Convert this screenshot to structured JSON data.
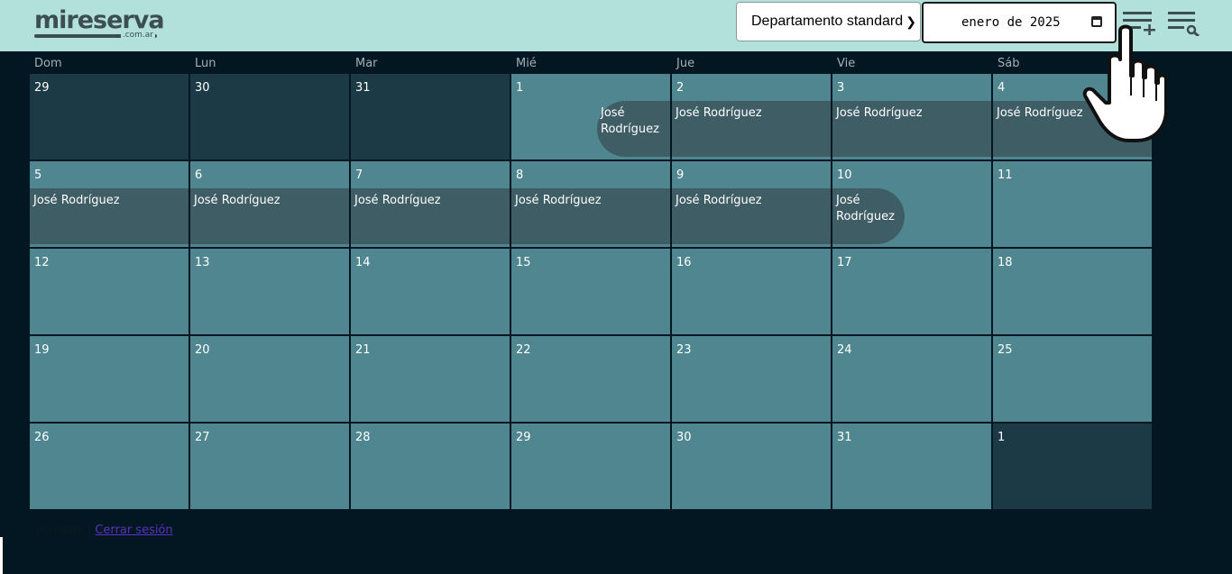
{
  "header": {
    "logo_text": "mireserva",
    "logo_tld": ".com.ar",
    "room_select": "Departamento standard",
    "month_value": "enero de 2025",
    "add_icon": "add-booking-icon",
    "search_icon": "search-booking-icon"
  },
  "calendar": {
    "weekdays": [
      "Dom",
      "Lun",
      "Mar",
      "Mié",
      "Jue",
      "Vie",
      "Sáb"
    ],
    "weeks": [
      [
        "29",
        "30",
        "31",
        "1",
        "2",
        "3",
        "4"
      ],
      [
        "5",
        "6",
        "7",
        "8",
        "9",
        "10",
        "11"
      ],
      [
        "12",
        "13",
        "14",
        "15",
        "16",
        "17",
        "18"
      ],
      [
        "19",
        "20",
        "21",
        "22",
        "23",
        "24",
        "25"
      ],
      [
        "26",
        "27",
        "28",
        "29",
        "30",
        "31",
        "1"
      ]
    ],
    "outside_month": [
      [
        0,
        0
      ],
      [
        0,
        1
      ],
      [
        0,
        2
      ],
      [
        4,
        6
      ]
    ],
    "guest_name": "José Rodríguez"
  },
  "footer": {
    "user": "Invitado |",
    "logout": "Cerrar sesión"
  },
  "colors": {
    "topbar": "#b2e0db",
    "background": "#021722",
    "day_cell": "#4f8690",
    "outside_cell": "#1c3a45",
    "booking": "#3f5d65"
  }
}
